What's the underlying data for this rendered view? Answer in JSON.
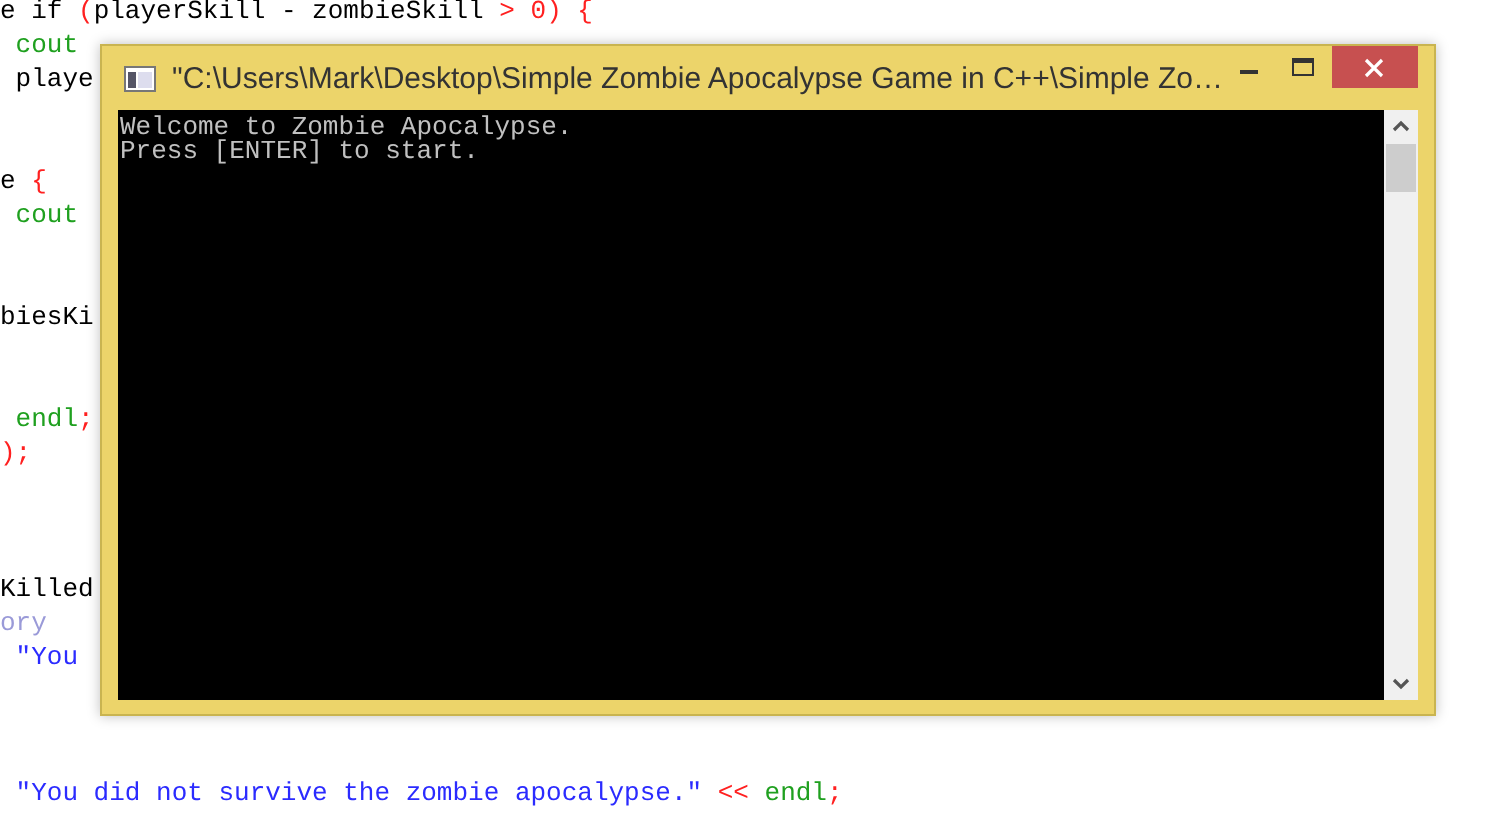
{
  "editor": {
    "blocks": [
      {
        "lines": [
          {
            "tokens": [
              {
                "text": "e if ",
                "kind": "plain"
              },
              {
                "text": "(",
                "kind": "operator"
              },
              {
                "text": "playerSkill - zombieSkill ",
                "kind": "plain"
              },
              {
                "text": "> 0) {",
                "kind": "operator"
              }
            ]
          },
          {
            "tokens": [
              {
                "text": " cout",
                "kind": "stream"
              }
            ]
          },
          {
            "tokens": [
              {
                "text": " playe",
                "kind": "plain"
              }
            ]
          }
        ]
      },
      {
        "lines": [
          {
            "tokens": [
              {
                "text": "e ",
                "kind": "plain"
              },
              {
                "text": "{",
                "kind": "operator"
              }
            ]
          },
          {
            "tokens": [
              {
                "text": " cout",
                "kind": "stream"
              }
            ]
          }
        ]
      },
      {
        "lines": [
          {
            "tokens": [
              {
                "text": "biesKi",
                "kind": "plain"
              }
            ]
          }
        ]
      },
      {
        "lines": [
          {
            "tokens": [
              {
                "text": " endl",
                "kind": "stream"
              },
              {
                "text": ";",
                "kind": "operator"
              }
            ]
          },
          {
            "tokens": [
              {
                "text": ");",
                "kind": "operator"
              }
            ]
          }
        ]
      },
      {
        "lines": [
          {
            "tokens": [
              {
                "text": "Killed",
                "kind": "plain"
              }
            ]
          },
          {
            "tokens": [
              {
                "text": "ory",
                "kind": "faded"
              }
            ]
          },
          {
            "tokens": [
              {
                "text": " \"You",
                "kind": "string"
              }
            ]
          }
        ]
      },
      {
        "lines": [
          {
            "tokens": [
              {
                "text": " \"You did not survive the zombie apocalypse.\"",
                "kind": "string"
              },
              {
                "text": " << ",
                "kind": "operator"
              },
              {
                "text": "endl",
                "kind": "stream"
              },
              {
                "text": ";",
                "kind": "operator"
              }
            ]
          }
        ]
      }
    ]
  },
  "console": {
    "title": "\"C:\\Users\\Mark\\Desktop\\Simple Zombie Apocalypse Game in C++\\Simple Zo…",
    "output": [
      "Welcome to Zombie Apocalypse.",
      "Press [ENTER] to start."
    ]
  }
}
